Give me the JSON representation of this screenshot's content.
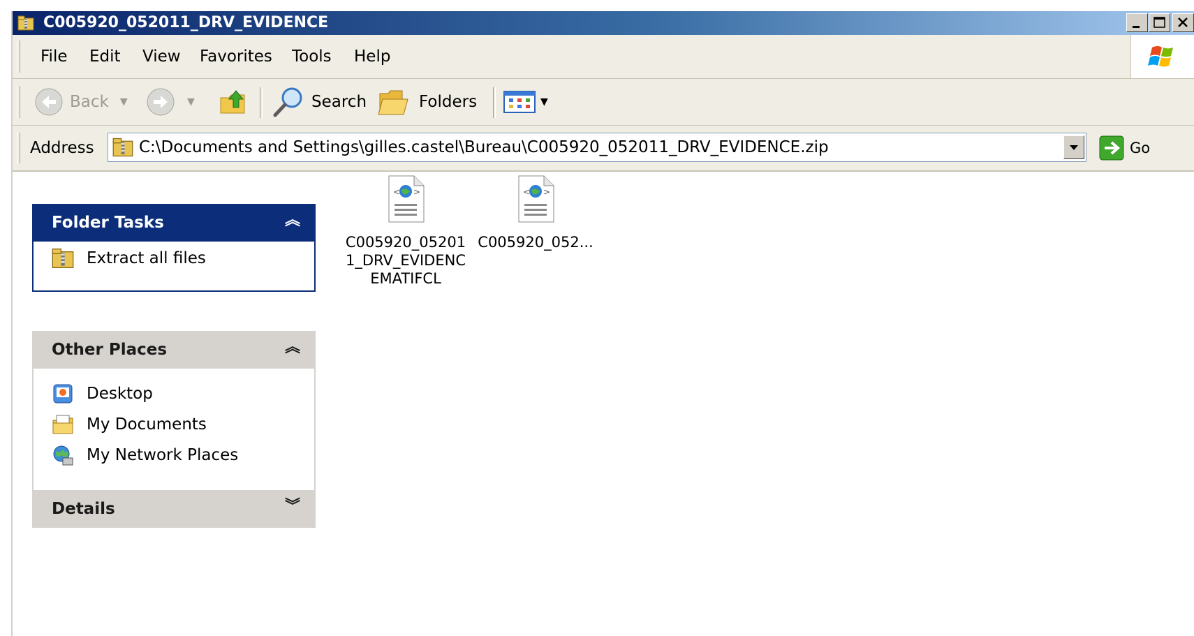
{
  "window": {
    "title": "C005920_052011_DRV_EVIDENCE"
  },
  "menu": [
    "File",
    "Edit",
    "View",
    "Favorites",
    "Tools",
    "Help"
  ],
  "toolbar": {
    "back_label": "Back",
    "search_label": "Search",
    "folders_label": "Folders"
  },
  "address": {
    "label": "Address",
    "path": "C:\\Documents and Settings\\gilles.castel\\Bureau\\C005920_052011_DRV_EVIDENCE.zip",
    "go_label": "Go"
  },
  "folder_tasks": {
    "title": "Folder Tasks",
    "items": [
      "Extract all files"
    ]
  },
  "other_places": {
    "title": "Other Places",
    "items": [
      "Desktop",
      "My Documents",
      "My Network Places"
    ]
  },
  "details": {
    "title": "Details"
  },
  "files": [
    {
      "name_lines": [
        "C005920_05201",
        "1_DRV_EVIDENC",
        "EMATIFCL"
      ]
    },
    {
      "name_lines": [
        "C005920_052..."
      ]
    }
  ],
  "colors": {
    "title_start": "#0a246a",
    "title_end": "#a6caf0",
    "task_header_dark": "#0c2e7a",
    "task_header_light": "#d6d3ce"
  }
}
